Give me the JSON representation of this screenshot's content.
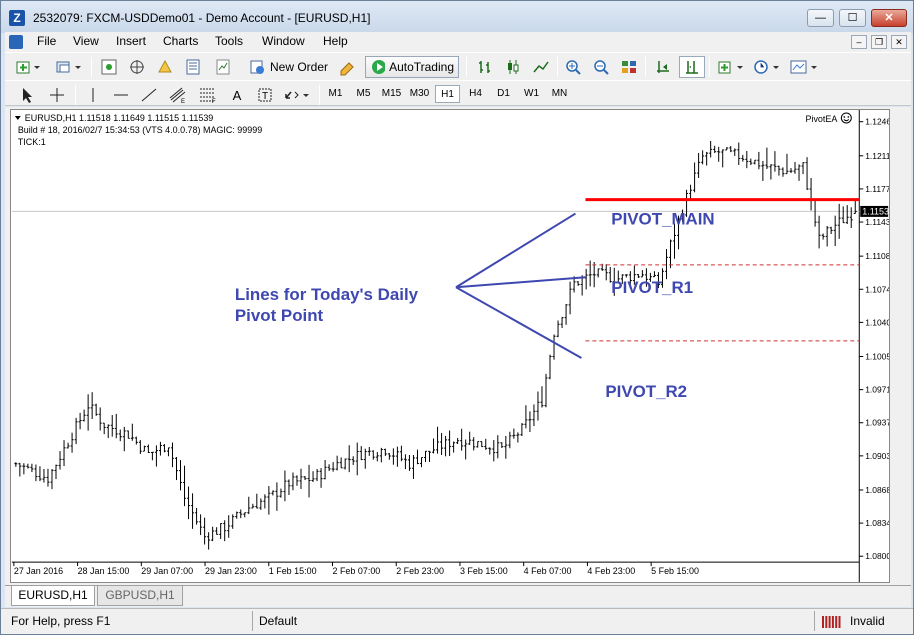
{
  "window": {
    "title": "2532079: FXCM-USDDemo01 - Demo Account - [EURUSD,H1]",
    "min_symbol": "—",
    "max_symbol": "☐",
    "close_symbol": "✕",
    "app_icon": "Z"
  },
  "menu": {
    "items": [
      "File",
      "View",
      "Insert",
      "Charts",
      "Tools",
      "Window",
      "Help"
    ]
  },
  "toolbar": {
    "new_order_label": "New Order",
    "autotrading_label": "AutoTrading"
  },
  "timeframes": [
    "M1",
    "M5",
    "M15",
    "M30",
    "H1",
    "H4",
    "D1",
    "W1",
    "MN"
  ],
  "selected_timeframe": "H1",
  "chart": {
    "info_line1": "EURUSD,H1  1.11518 1.11649 1.11515 1.11539",
    "info_line2": "Build # 18, 2016/02/7 15:34:53  (VTS 4.0.0.78) MAGIC: 99999",
    "info_line3": "TICK:1",
    "ea_name": "PivotEA",
    "current_price": "1.11539",
    "annotation_line1": "Lines for Today's Daily",
    "annotation_line2": "Pivot Point",
    "label_main": "PIVOT_MAIN",
    "label_r1": "PIVOT_R1",
    "label_r2": "PIVOT_R2",
    "colors": {
      "pivot_main": "#ff0000",
      "pivot_dashed": "#cc3333",
      "annotation": "#3f48b0",
      "price_tag_bg": "#000000"
    }
  },
  "chart_data": {
    "type": "candlestick",
    "symbol": "EURUSD",
    "timeframe": "H1",
    "y_ticks": [
      "1.12460",
      "1.12110",
      "1.11770",
      "1.11430",
      "1.11080",
      "1.10740",
      "1.10400",
      "1.10050",
      "1.09710",
      "1.09370",
      "1.09030",
      "1.08680",
      "1.08340",
      "1.08000"
    ],
    "y_tick_values": [
      1.1246,
      1.1211,
      1.1177,
      1.1143,
      1.1108,
      1.1074,
      1.104,
      1.1005,
      1.0971,
      1.0937,
      1.0903,
      1.0868,
      1.0834,
      1.08
    ],
    "ylim": [
      1.0795,
      1.1258
    ],
    "x_labels": [
      "27 Jan 2016",
      "28 Jan 15:00",
      "29 Jan 07:00",
      "29 Jan 23:00",
      "1 Feb 15:00",
      "2 Feb 07:00",
      "2 Feb 23:00",
      "3 Feb 15:00",
      "4 Feb 07:00",
      "4 Feb 23:00",
      "5 Feb 15:00"
    ],
    "bar_count": 210,
    "price_path": [
      [
        0,
        1.0895
      ],
      [
        8,
        1.088
      ],
      [
        12,
        1.091
      ],
      [
        18,
        1.0955
      ],
      [
        22,
        1.0935
      ],
      [
        28,
        1.0925
      ],
      [
        33,
        1.0905
      ],
      [
        38,
        1.0915
      ],
      [
        42,
        1.086
      ],
      [
        47,
        1.082
      ],
      [
        52,
        1.083
      ],
      [
        58,
        1.085
      ],
      [
        63,
        1.086
      ],
      [
        68,
        1.0875
      ],
      [
        74,
        1.088
      ],
      [
        80,
        1.0895
      ],
      [
        86,
        1.0905
      ],
      [
        92,
        1.091
      ],
      [
        98,
        1.0895
      ],
      [
        104,
        1.091
      ],
      [
        110,
        1.092
      ],
      [
        116,
        1.0915
      ],
      [
        121,
        1.091
      ],
      [
        126,
        1.093
      ],
      [
        131,
        1.096
      ],
      [
        134,
        1.103
      ],
      [
        139,
        1.108
      ],
      [
        144,
        1.109
      ],
      [
        150,
        1.1085
      ],
      [
        156,
        1.109
      ],
      [
        160,
        1.108
      ],
      [
        163,
        1.112
      ],
      [
        168,
        1.118
      ],
      [
        171,
        1.121
      ],
      [
        175,
        1.1215
      ],
      [
        181,
        1.121
      ],
      [
        187,
        1.12
      ],
      [
        192,
        1.1195
      ],
      [
        196,
        1.12
      ],
      [
        200,
        1.1125
      ],
      [
        204,
        1.114
      ],
      [
        209,
        1.1154
      ]
    ],
    "last": {
      "open": 1.11518,
      "high": 1.11649,
      "low": 1.11515,
      "close": 1.11539
    },
    "pivot_main": 1.1166,
    "pivot_r1": 1.1099,
    "pivot_r2": 1.1021
  },
  "tabs": [
    "EURUSD,H1",
    "GBPUSD,H1"
  ],
  "status": {
    "help": "For Help, press F1",
    "profile": "Default",
    "connection": "Invalid"
  },
  "icons": [
    "new-chart-icon",
    "profiles-icon",
    "market-watch-icon",
    "navigator-icon",
    "data-window-icon",
    "terminal-icon",
    "new-order-icon",
    "metaeditor-icon",
    "autotrading-icon",
    "bar-chart-icon",
    "candles-icon",
    "line-chart-icon",
    "zoom-in-icon",
    "zoom-out-icon",
    "tile-icon",
    "autoscroll-icon",
    "chart-shift-icon",
    "indicators-icon",
    "periods-icon",
    "templates-icon",
    "cursor-icon",
    "crosshair-icon",
    "vertical-line-icon",
    "horizontal-line-icon",
    "trendline-icon",
    "equidistant-icon",
    "fibo-icon",
    "text-icon",
    "text-label-icon",
    "arrows-icon",
    "smiley-icon"
  ]
}
